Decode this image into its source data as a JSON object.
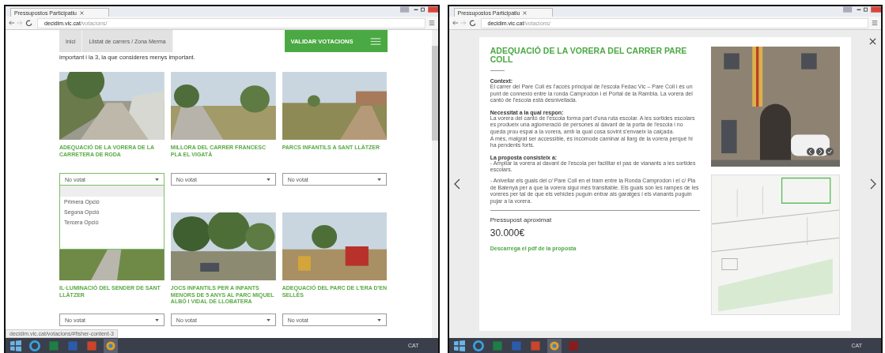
{
  "left_window": {
    "browser": {
      "tab_title": "Pressupostos Participatiu",
      "url_host": "decidim.vic.cat",
      "url_path": "/votacions/"
    },
    "nav": {
      "items": [
        "Inici",
        "Llistat de carrers / Zona Merma"
      ],
      "button": "VALIDAR VOTACIONS"
    },
    "intro": "important i la 3, la que consideres menys important.",
    "proposals": [
      {
        "title": "ADEQUACIÓ DE LA VORERA DE LA CARRETERA DE RODA",
        "vote": "No votat",
        "open": true,
        "options": [
          "Primera Opció",
          "Segona Opció",
          "Tercera Opció"
        ]
      },
      {
        "title": "MILLORA DEL CARRER FRANCESC PLA EL VIGATÀ",
        "vote": "No votat",
        "open": false
      },
      {
        "title": "PARCS INFANTILS A SANT LLÀTZER",
        "vote": "No votat",
        "open": false
      },
      {
        "title": "IL·LUMINACIÓ DEL SENDER DE SANT LLÀTZER",
        "vote": "No votat",
        "open": false
      },
      {
        "title": "JOCS INFANTILS PER A INFANTS MENORS DE 5 ANYS AL PARC MIQUEL ALBÓ I VIDAL DE LLOBATERA",
        "vote": "No votat",
        "open": false
      },
      {
        "title": "ADEQUACIÓ DEL PARC DE L'ERA D'EN SELLÉS",
        "vote": "No votat",
        "open": false
      }
    ],
    "status_text": "decidim.vic.cat/votacions/#fisher-content-3",
    "taskbar": {
      "language": "CAT"
    }
  },
  "right_window": {
    "browser": {
      "tab_title": "Pressupostos Participatiu",
      "url_host": "decidim.vic.cat",
      "url_path": "/votacions/"
    },
    "modal": {
      "title": "ADEQUACIÓ DE LA VORERA DEL CARRER PARE COLL",
      "sections": [
        {
          "heading": "Context:",
          "paragraphs": [
            "El carrer del Pare Coll és l'accés principal de l'escola Fedac Vic – Pare Coll i és un punt de connexió entre la ronda Camprodon i el Portal de la Rambla. La vorera del cantó de l'escola està desnivellada."
          ]
        },
        {
          "heading": "Necessitat a la qual respon:",
          "paragraphs": [
            "La vorera del cantó de l'escola forma part d'una ruta escolar. A les sortides escolars es produeix una aglomeració de persones al davant de la porta de l'escola i no queda prou espai a la vorera, amb la qual cosa sovint s'envaeix la calçada.",
            "A més, malgrat ser accessible, és incòmode caminar al llarg de la vorera perquè hi ha pendents forts."
          ]
        },
        {
          "heading": "La proposta consisteix a:",
          "paragraphs": [
            "- Ampliar la vorera al davant de l'escola per facilitar el pas de vianants a les sortides escolars.",
            "- Anivellar els guals del c/ Pare Coll en el tram entre la Ronda Camprodon i el c/ Pla de Balenyà per a que la vorera sigui més transitable. Els guals són les rampes de les voreres per tal de que els vehicles puguin entrar als garatges i els vianants puguin pujar a la vorera."
          ]
        }
      ],
      "budget_label": "Pressupost aproximat",
      "budget": "30.000€",
      "link": "Descarrega el pdf de la proposta"
    },
    "taskbar": {
      "language": "CAT"
    }
  }
}
